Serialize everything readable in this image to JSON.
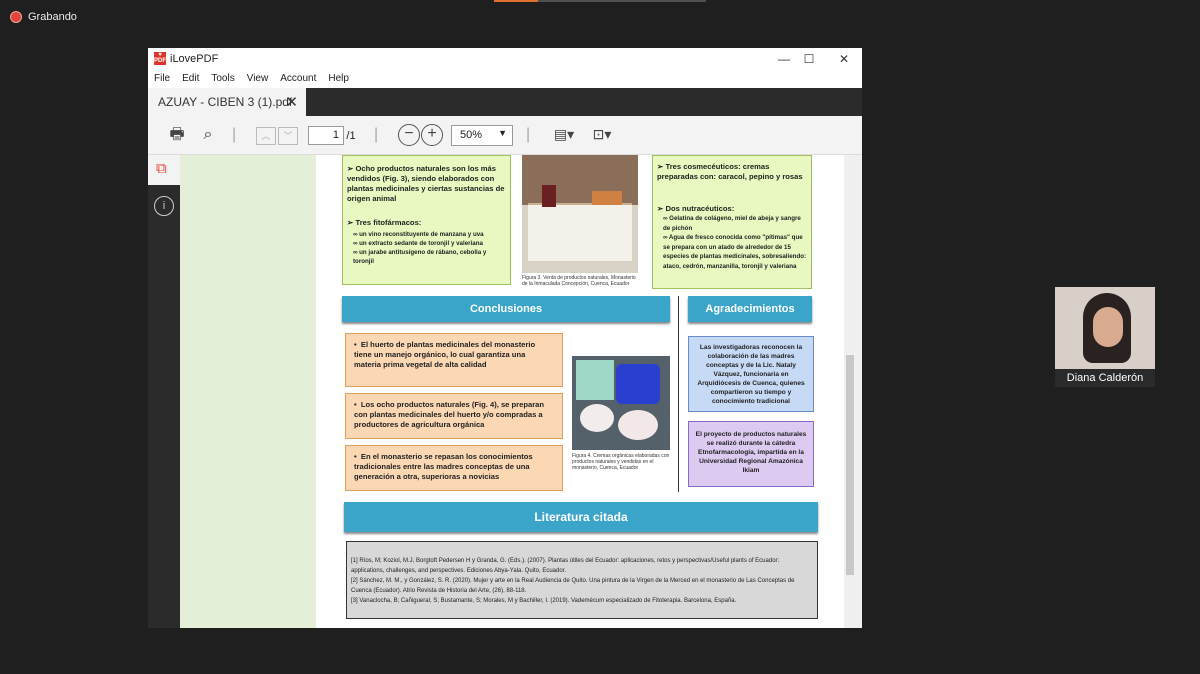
{
  "recording_label": "Grabando",
  "window": {
    "title": "iLovePDF",
    "menu": [
      "File",
      "Edit",
      "Tools",
      "View",
      "Account",
      "Help"
    ],
    "tab_label": "AZUAY - CIBEN 3 (1).pdf",
    "page_current": "1",
    "page_total": "/1",
    "zoom": "50%"
  },
  "pdf": {
    "left_box": {
      "item1": "Ocho productos naturales son los más vendidos (Fig. 3), siendo elaborados con plantas medicinales y ciertas sustancias de origen animal",
      "item2": "Tres fitofármacos:",
      "sub": [
        "un vino reconstituyente de manzana y uva",
        "un extracto sedante de toronjil y valeriana",
        "un jarabe antitusígeno de rábano, cebolla y toronjil"
      ]
    },
    "fig3_caption": "Figura 3. Venta de productos naturales, Monasterio de la Inmaculada Concepción, Cuenca, Ecuador",
    "right_box": {
      "item1": "Tres cosmecéuticos: cremas preparadas con: caracol, pepino y rosas",
      "item2": "Dos nutracéuticos:",
      "sub": [
        "Gelatina de colágeno, miel de abeja y sangre de pichón",
        "Agua de fresco conocida como \"pítimas\" que se prepara con un atado de alrededor de 15 especies de plantas medicinales, sobresaliendo: ataco, cedrón, manzanilla, toronjil y valeriana"
      ]
    },
    "conclusiones_title": "Conclusiones",
    "agradecimientos_title": "Agradecimientos",
    "conclusiones": [
      "El huerto de plantas medicinales del monasterio tiene un manejo orgánico, lo cual garantiza una materia prima vegetal de alta calidad",
      "Los ocho productos naturales (Fig. 4), se preparan con plantas medicinales del huerto y/o compradas a productores de agricultura orgánica",
      "En el monasterio se repasan los conocimientos tradicionales entre las madres conceptas de una generación a otra, superioras a novicias"
    ],
    "fig4_caption": "Figura 4. Cremas orgánicas elaboradas con productos naturales y vendidas en el monasterio, Cuenca, Ecuador",
    "agradecimientos": [
      "Las investigadoras reconocen la colaboración de las madres conceptas y de la Lic. Nataly Vázquez, funcionaria en Arquidiócesis de Cuenca, quienes compartieron su tiempo y conocimiento tradicional",
      "El proyecto de productos naturales se realizó durante la cátedra Etnofarmacología, impartida en la Universidad Regional Amazónica Ikiam"
    ],
    "literatura_title": "Literatura citada",
    "refs": [
      "[1] Ríos, M; Koziol, M.J, Borgtoft Pedersen H y Granda, G. (Eds.). (2007). Plantas útiles del Ecuador: aplicaciones, retos y perspectivas/Useful plants of Ecuador: applications, challenges, and perspectives. Ediciones Abya-Yala. Quito, Ecuador.",
      "[2] Sánchez, M. M., y González, S. R. (2020). Mujer y arte en la Real Audiencia de Quito. Una pintura de la Virgen de la Merced en el monasterio de Las Conceptas de Cuenca (Ecuador). Atrio Revista de Historia del Arte, (26), 88-118.",
      "[3] Vanaclocha, B; Cañigueral, S; Bustamante, S; Morales, M y Bachiller, I. (2019). Vademécum especializado de Fitoterapia. Barcelona, España."
    ]
  },
  "participant_name": "Diana Calderón"
}
